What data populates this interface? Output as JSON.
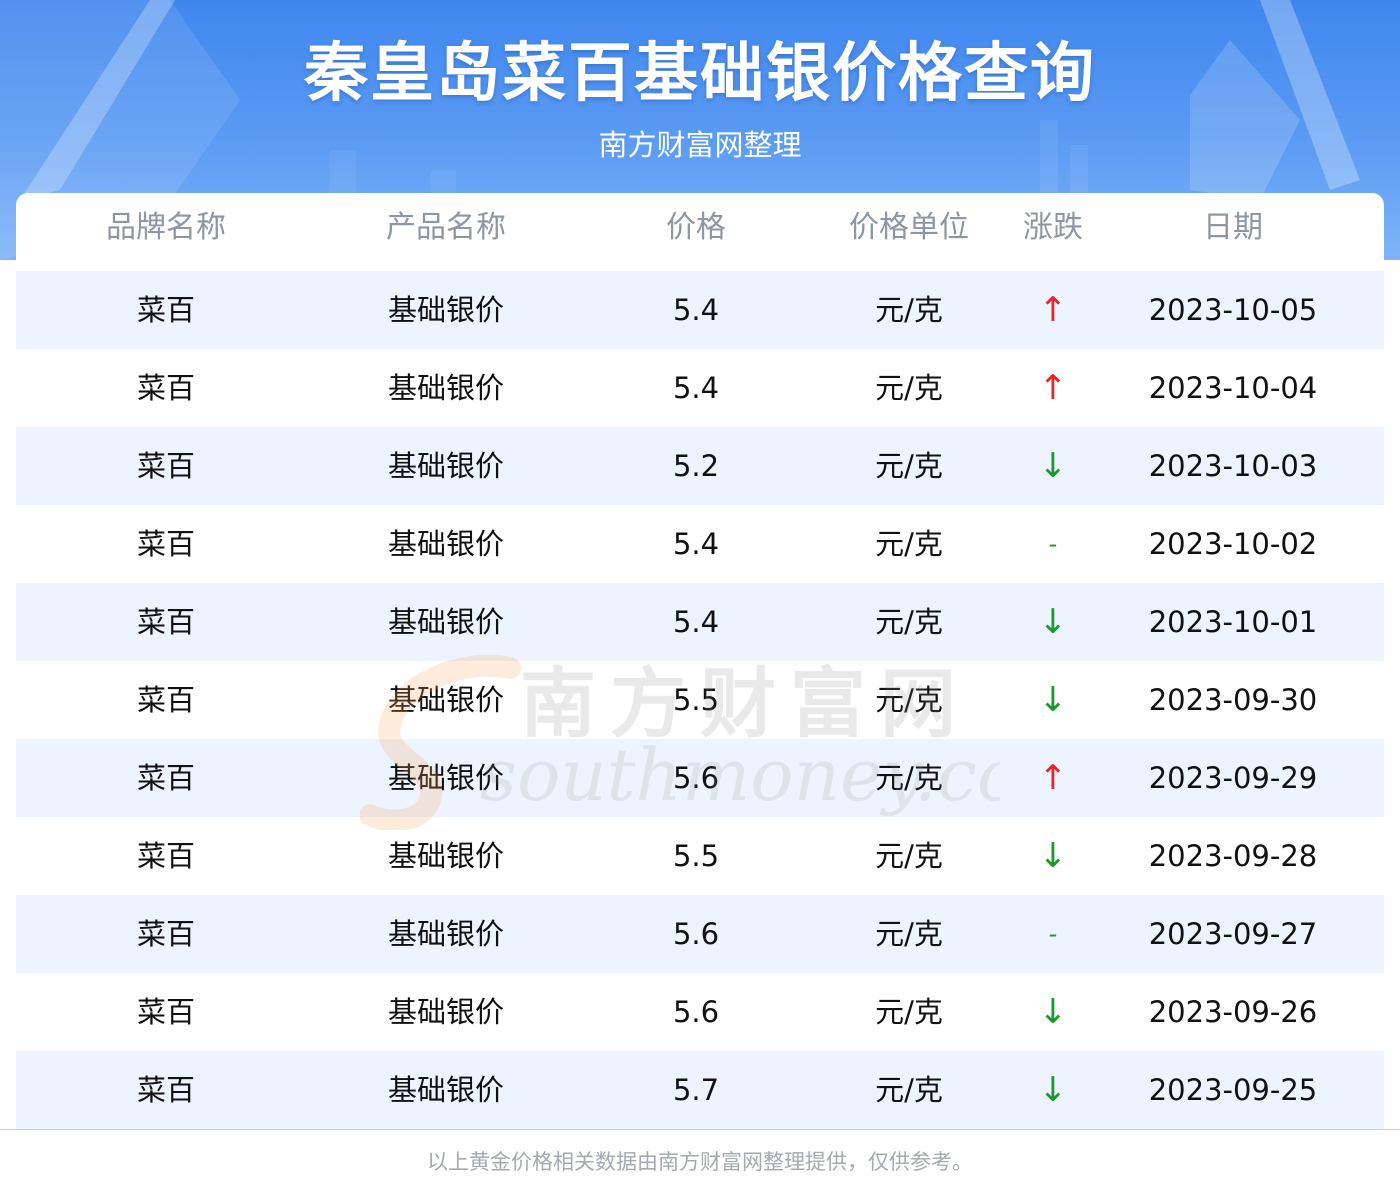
{
  "header": {
    "title": "秦皇岛菜百基础银价格查询",
    "subtitle": "南方财富网整理"
  },
  "colors": {
    "header_blue": "#3f86ee",
    "row_stripe": "#eef4ff",
    "up_red": "#e8262a",
    "down_green": "#1a9a2c"
  },
  "table": {
    "columns": [
      "品牌名称",
      "产品名称",
      "价格",
      "价格单位",
      "涨跌",
      "日期"
    ],
    "rows": [
      {
        "brand": "菜百",
        "product": "基础银价",
        "price": "5.4",
        "unit": "元/克",
        "trend": "↑",
        "trend_dir": "up",
        "date": "2023-10-05"
      },
      {
        "brand": "菜百",
        "product": "基础银价",
        "price": "5.4",
        "unit": "元/克",
        "trend": "↑",
        "trend_dir": "up",
        "date": "2023-10-04"
      },
      {
        "brand": "菜百",
        "product": "基础银价",
        "price": "5.2",
        "unit": "元/克",
        "trend": "↓",
        "trend_dir": "down",
        "date": "2023-10-03"
      },
      {
        "brand": "菜百",
        "product": "基础银价",
        "price": "5.4",
        "unit": "元/克",
        "trend": "-",
        "trend_dir": "flat",
        "date": "2023-10-02"
      },
      {
        "brand": "菜百",
        "product": "基础银价",
        "price": "5.4",
        "unit": "元/克",
        "trend": "↓",
        "trend_dir": "down",
        "date": "2023-10-01"
      },
      {
        "brand": "菜百",
        "product": "基础银价",
        "price": "5.5",
        "unit": "元/克",
        "trend": "↓",
        "trend_dir": "down",
        "date": "2023-09-30"
      },
      {
        "brand": "菜百",
        "product": "基础银价",
        "price": "5.6",
        "unit": "元/克",
        "trend": "↑",
        "trend_dir": "up",
        "date": "2023-09-29"
      },
      {
        "brand": "菜百",
        "product": "基础银价",
        "price": "5.5",
        "unit": "元/克",
        "trend": "↓",
        "trend_dir": "down",
        "date": "2023-09-28"
      },
      {
        "brand": "菜百",
        "product": "基础银价",
        "price": "5.6",
        "unit": "元/克",
        "trend": "-",
        "trend_dir": "flat",
        "date": "2023-09-27"
      },
      {
        "brand": "菜百",
        "product": "基础银价",
        "price": "5.6",
        "unit": "元/克",
        "trend": "↓",
        "trend_dir": "down",
        "date": "2023-09-26"
      },
      {
        "brand": "菜百",
        "product": "基础银价",
        "price": "5.7",
        "unit": "元/克",
        "trend": "↓",
        "trend_dir": "down",
        "date": "2023-09-25"
      }
    ]
  },
  "watermark": {
    "cn": "南方财富网",
    "en": "southmoney.com"
  },
  "footer": {
    "note": "以上黄金价格相关数据由南方财富网整理提供，仅供参考。"
  }
}
